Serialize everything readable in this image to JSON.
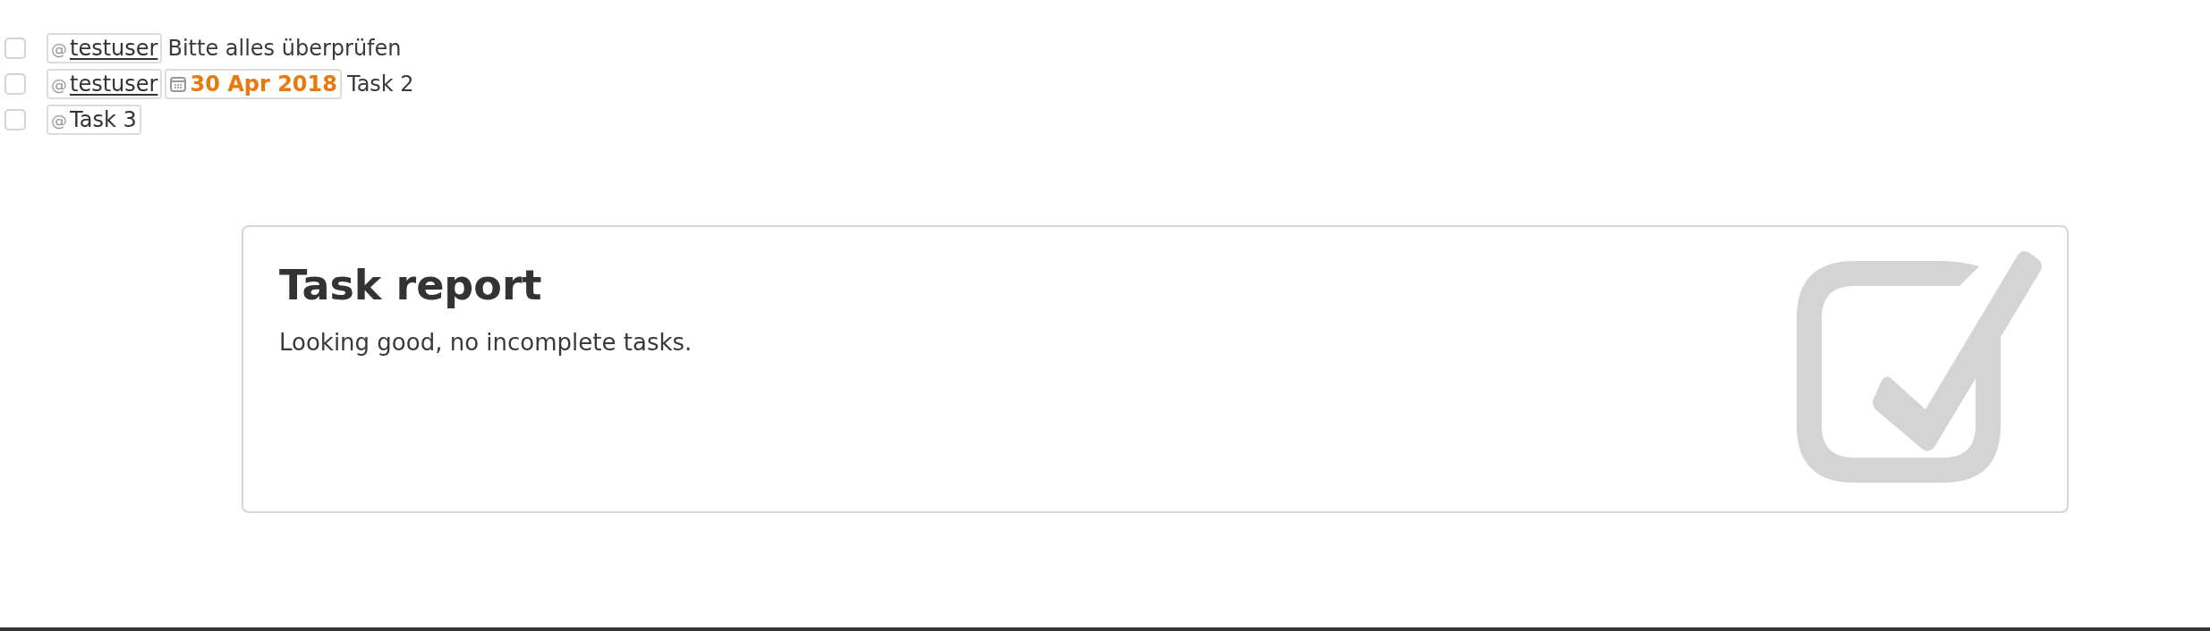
{
  "tasks": [
    {
      "checked": false,
      "parts": [
        {
          "kind": "mention",
          "symbol": "@",
          "text": "testuser"
        },
        {
          "kind": "text",
          "text": "Bitte alles überprüfen"
        }
      ]
    },
    {
      "checked": false,
      "parts": [
        {
          "kind": "mention",
          "symbol": "@",
          "text": "testuser"
        },
        {
          "kind": "date",
          "text": "30 Apr 2018"
        },
        {
          "kind": "text",
          "text": "Task 2"
        }
      ]
    },
    {
      "checked": false,
      "parts": [
        {
          "kind": "tag",
          "symbol": "@",
          "text": "Task 3"
        }
      ]
    }
  ],
  "report": {
    "title": "Task report",
    "message": "Looking good, no incomplete tasks."
  }
}
